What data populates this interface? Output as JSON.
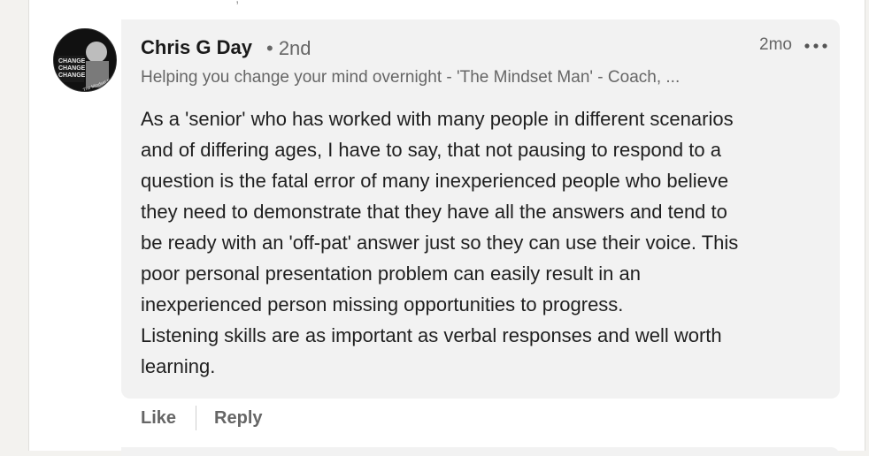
{
  "comment": {
    "top_fragment": ", ·",
    "author": "Chris G Day",
    "degree": "• 2nd",
    "time": "2mo",
    "headline": "Helping you change your mind overnight - 'The Mindset Man' - Coach, ...",
    "body_lines": [
      "As a 'senior' who has worked with many people in different scenarios",
      "and of differing ages, I have to say, that not pausing to respond to a",
      "question is the fatal error of many inexperienced people who believe",
      "they need to demonstrate that they have all the answers and tend to",
      "be ready with an 'off-pat' answer just so they can use their voice. This",
      "poor personal presentation problem can easily result in an",
      "inexperienced person missing opportunities to progress.",
      "Listening skills are as important as verbal responses and well worth",
      "learning."
    ],
    "avatar_lines": [
      "CHANGE",
      "CHANGE",
      "CHANGE"
    ],
    "avatar_caption": "The Mindset Man",
    "more_icon": "ellipsis-icon"
  },
  "actions": {
    "like": "Like",
    "reply": "Reply"
  }
}
